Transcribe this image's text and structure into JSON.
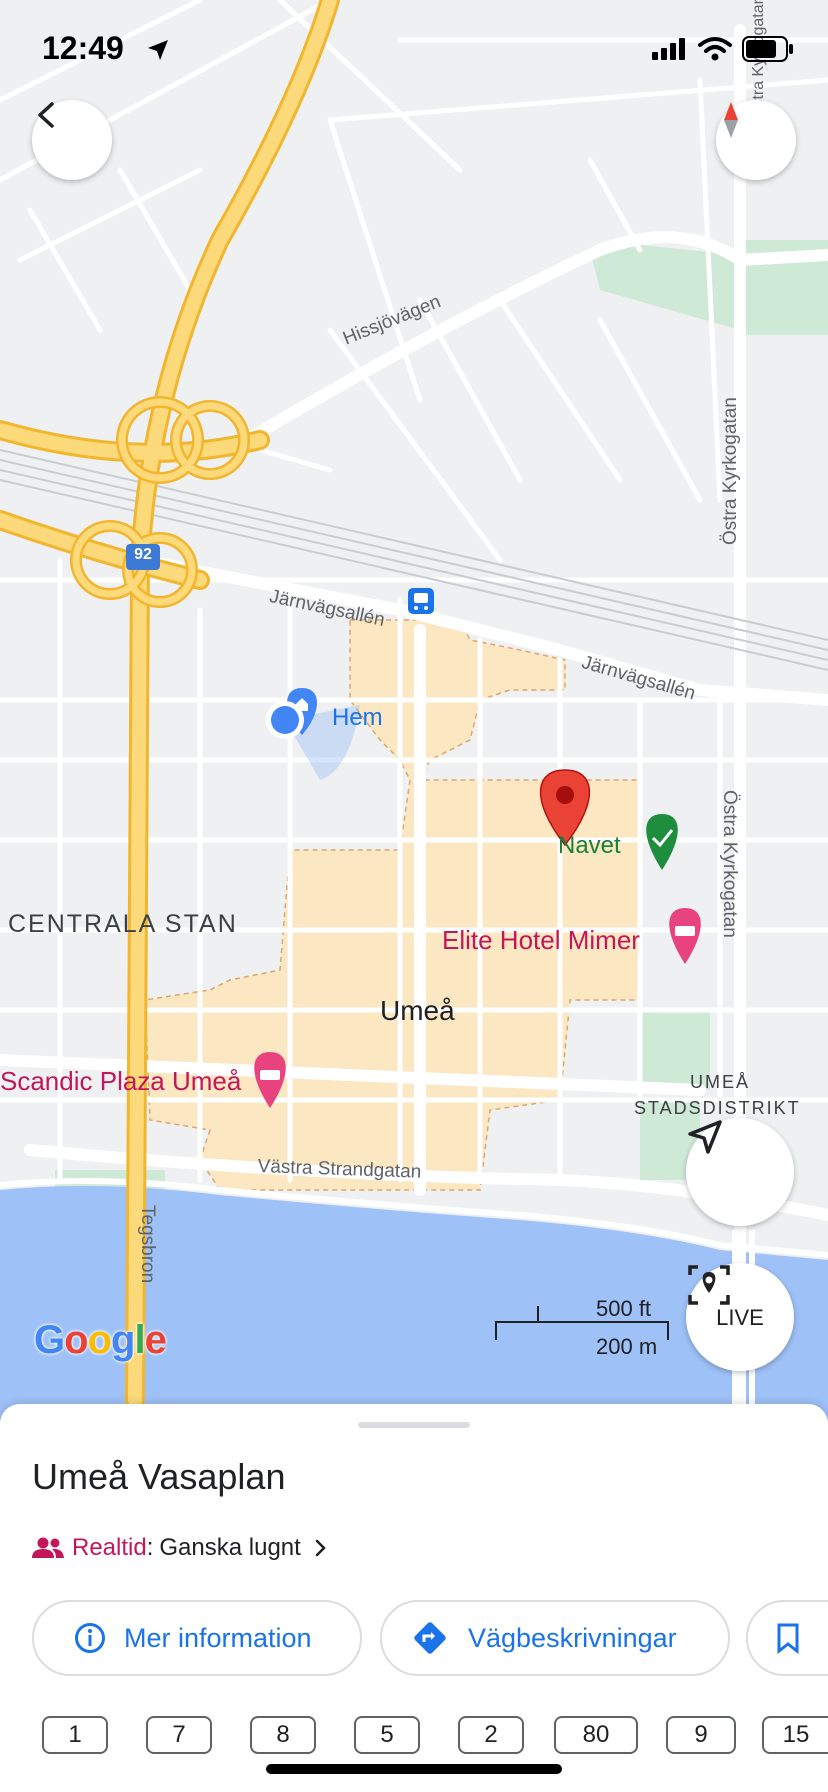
{
  "status_bar": {
    "time": "12:49"
  },
  "map": {
    "labels": {
      "hissjovagen": "Hissjövägen",
      "ostra_kyrkogatan_top": "Östra Kyrkogatan",
      "ostra_kyrkogatan_bottom": "Östra Kyrkogatan",
      "jarnvagsallen_left": "Järnvägsallén",
      "jarnvagsallen_right": "Järnvägsallén",
      "highway_shield": "92",
      "hem": "Hem",
      "navet": "Navet",
      "centrala_stan": "CENTRALA STAN",
      "elite_hotel": "Elite Hotel Mimer",
      "umea": "Umeå",
      "scandic": "Scandic Plaza Umeå",
      "stadsdistrikt_1": "UMEÅ",
      "stadsdistrikt_2": "STADSDISTRIKT",
      "vastra_strandgatan": "Västra Strandgatan",
      "tegsbron": "Tegsbron",
      "ostra_kyrkogatan_top_right": "Östra Kyrkogatan"
    },
    "scale": {
      "ft": "500 ft",
      "m": "200 m"
    },
    "google_logo": "Google",
    "live_label": "LIVE",
    "icons": {
      "back": "chevron-left-icon",
      "compass": "compass-icon",
      "locate": "navigation-arrow-icon",
      "live": "live-view-icon"
    }
  },
  "sheet": {
    "title": "Umeå Vasaplan",
    "realtime_label": "Realtid",
    "realtime_sep": ":",
    "realtime_value": "Ganska lugnt",
    "chips": {
      "info": "Mer information",
      "directions": "Vägbeskrivningar"
    },
    "routes": [
      "1",
      "7",
      "8",
      "5",
      "2",
      "80",
      "9",
      "15"
    ]
  },
  "colors": {
    "accent": "#1a73e8",
    "pin_red": "#ea4335",
    "poi_pink": "#c2185b",
    "poi_green": "#188038",
    "water": "#9ec1f7",
    "highway": "#f6c548"
  }
}
